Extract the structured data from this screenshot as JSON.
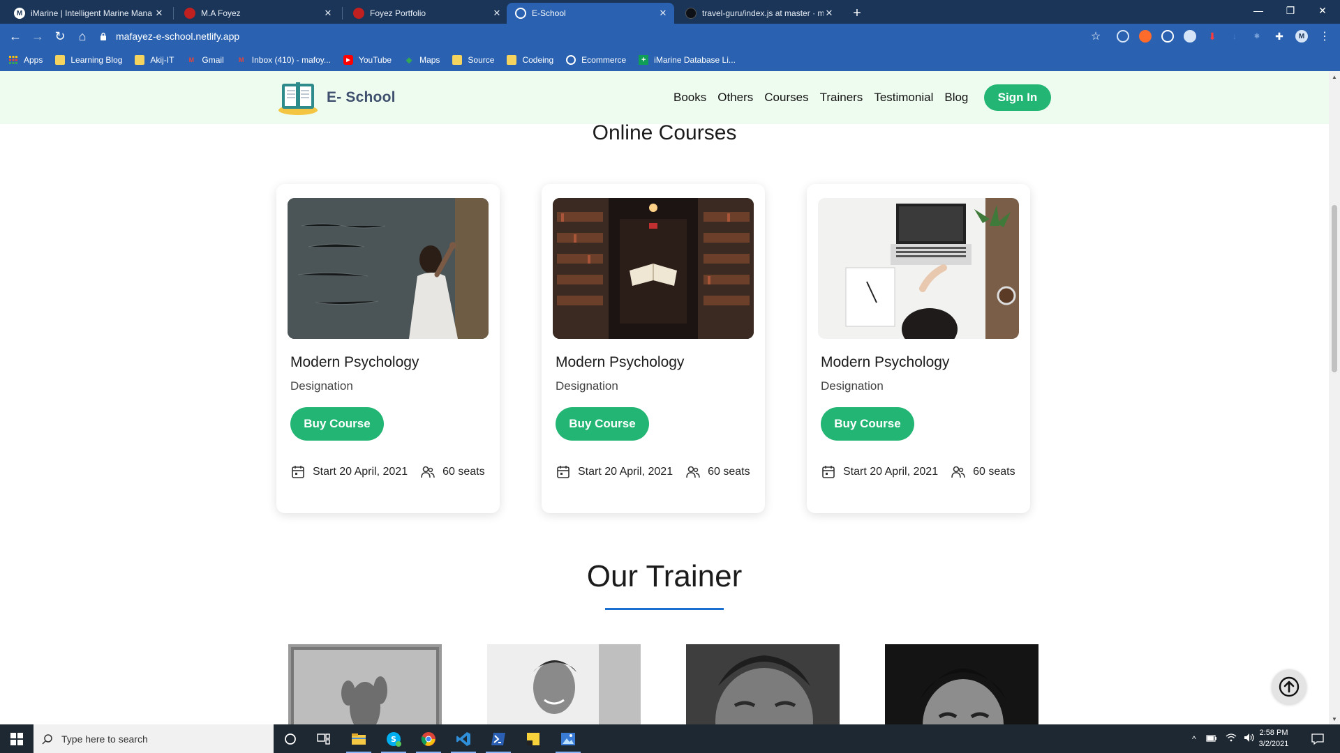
{
  "browser": {
    "tabs": [
      {
        "title": "iMarine | Intelligent Marine Mana",
        "active": false
      },
      {
        "title": "M.A Foyez",
        "active": false
      },
      {
        "title": "Foyez Portfolio",
        "active": false
      },
      {
        "title": "E-School",
        "active": true
      },
      {
        "title": "travel-guru/index.js at master · m",
        "active": false
      }
    ],
    "url": "mafayez-e-school.netlify.app",
    "profile_initial": "M",
    "bookmarks": [
      "Apps",
      "Learning Blog",
      "Akij-IT",
      "Gmail",
      "Inbox (410) - mafoy...",
      "YouTube",
      "Maps",
      "Source",
      "Codeing",
      "Ecommerce",
      "iMarine Database Li..."
    ]
  },
  "site": {
    "brand": "E- School",
    "nav": [
      "Books",
      "Others",
      "Courses",
      "Trainers",
      "Testimonial",
      "Blog"
    ],
    "signin_label": "Sign In",
    "courses_heading": "Online Courses",
    "courses": [
      {
        "title": "Modern Psychology",
        "designation": "Designation",
        "button": "Buy Course",
        "start": "Start 20 April, 2021",
        "seats": "60 seats"
      },
      {
        "title": "Modern Psychology",
        "designation": "Designation",
        "button": "Buy Course",
        "start": "Start 20 April, 2021",
        "seats": "60 seats"
      },
      {
        "title": "Modern Psychology",
        "designation": "Designation",
        "button": "Buy Course",
        "start": "Start 20 April, 2021",
        "seats": "60 seats"
      }
    ],
    "trainer_heading": "Our Trainer"
  },
  "taskbar": {
    "search_placeholder": "Type here to search",
    "time": "2:58 PM",
    "date": "3/2/2021"
  },
  "colors": {
    "brand_green": "#22b573",
    "nav_bg": "#eefcef",
    "chrome_blue": "#2a62b1",
    "accent_blue": "#1a6fd1"
  }
}
